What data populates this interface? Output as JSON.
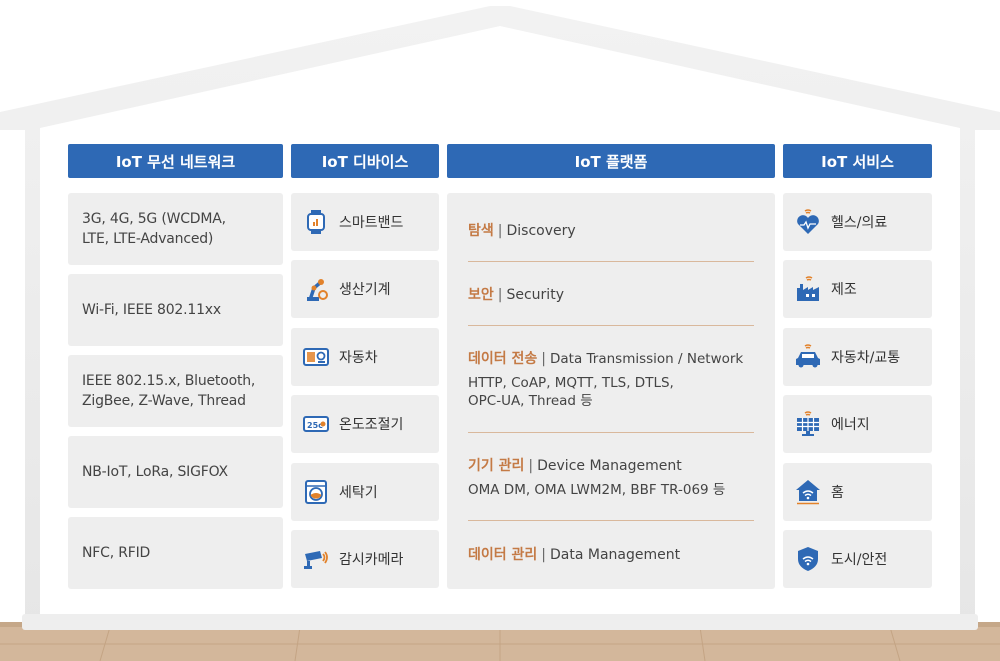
{
  "colors": {
    "header_bg": "#2e69b5",
    "accent_text": "#c47a45",
    "box_bg": "#eeeeee",
    "icon_blue": "#2e69b5",
    "icon_orange": "#e2822b"
  },
  "network": {
    "title": "IoT 무선 네트워크",
    "items": [
      {
        "line1": "3G, 4G, 5G (WCDMA,",
        "line2": "LTE, LTE-Advanced)"
      },
      {
        "line1": "Wi-Fi, IEEE 802.11xx",
        "line2": ""
      },
      {
        "line1": "IEEE 802.15.x, Bluetooth,",
        "line2": "ZigBee, Z-Wave, Thread"
      },
      {
        "line1": "NB-IoT, LoRa, SIGFOX",
        "line2": ""
      },
      {
        "line1": "NFC, RFID",
        "line2": ""
      }
    ]
  },
  "devices": {
    "title": "IoT 디바이스",
    "items": [
      {
        "label": "스마트밴드",
        "icon": "smartband-icon"
      },
      {
        "label": "생산기계",
        "icon": "robot-arm-icon"
      },
      {
        "label": "자동차",
        "icon": "car-dashboard-icon"
      },
      {
        "label": "온도조절기",
        "icon": "thermostat-icon"
      },
      {
        "label": "세탁기",
        "icon": "washing-machine-icon"
      },
      {
        "label": "감시카메라",
        "icon": "cctv-camera-icon"
      }
    ]
  },
  "platform": {
    "title": "IoT 플랫폼",
    "items": [
      {
        "title_kr": "탐색",
        "title_en": "Discovery",
        "sub1": "",
        "sub2": ""
      },
      {
        "title_kr": "보안",
        "title_en": "Security",
        "sub1": "",
        "sub2": ""
      },
      {
        "title_kr": "데이터 전송",
        "title_en": "Data Transmission / Network",
        "sub1": "HTTP, CoAP, MQTT, TLS, DTLS,",
        "sub2": "OPC-UA, Thread 등"
      },
      {
        "title_kr": "기기 관리",
        "title_en": "Device Management",
        "sub1": "OMA DM, OMA LWM2M, BBF TR-069 등",
        "sub2": ""
      },
      {
        "title_kr": "데이터 관리",
        "title_en": "Data Management",
        "sub1": "",
        "sub2": ""
      }
    ],
    "separator": "|"
  },
  "services": {
    "title": "IoT 서비스",
    "items": [
      {
        "label": "헬스/의료",
        "icon": "heart-health-icon"
      },
      {
        "label": "제조",
        "icon": "factory-icon"
      },
      {
        "label": "자동차/교통",
        "icon": "car-icon"
      },
      {
        "label": "에너지",
        "icon": "solar-panel-icon"
      },
      {
        "label": "홈",
        "icon": "smart-home-icon"
      },
      {
        "label": "도시/안전",
        "icon": "shield-icon"
      }
    ]
  },
  "thermostat_text": "25c"
}
